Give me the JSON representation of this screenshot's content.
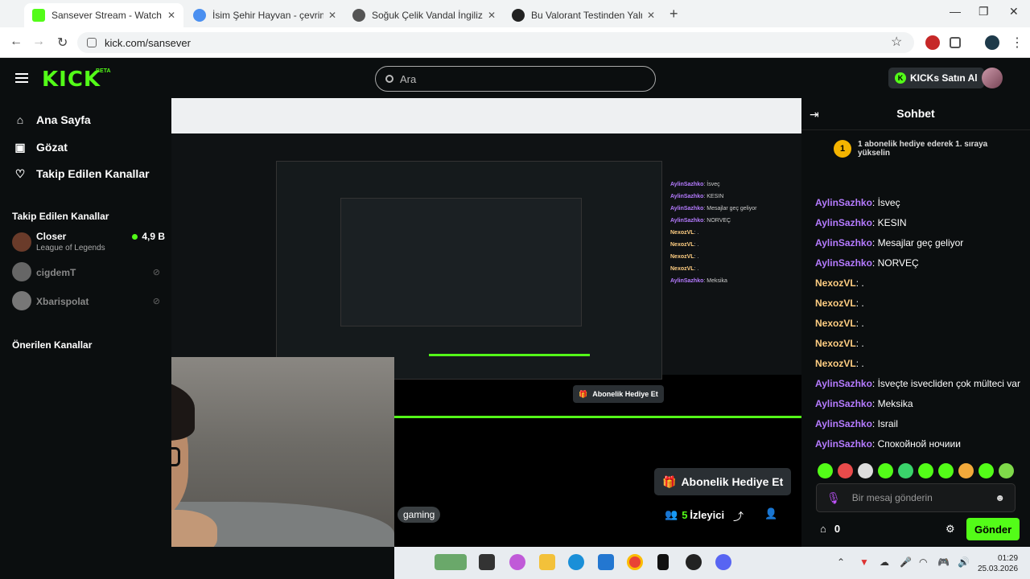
{
  "browser": {
    "tabs": [
      {
        "title": "Sansever Stream - Watch Live o",
        "favicon_color": "#53fc18",
        "active": true
      },
      {
        "title": "İsim Şehir Hayvan - çevrimiçi o",
        "favicon_color": "#4a8ff0",
        "active": false
      },
      {
        "title": "Soğuk Çelik Vandal İngilizcesi",
        "favicon_color": "#555555",
        "active": false
      },
      {
        "title": "Bu Valorant Testinden Yalnızca",
        "favicon_color": "#222222",
        "active": false
      }
    ],
    "url": "kick.com/sansever"
  },
  "header": {
    "logo": "KICK",
    "beta": "BETA",
    "search_placeholder": "Ara",
    "buy_kicks": "KICKs Satın Al"
  },
  "sidebar": {
    "nav": [
      {
        "label": "Ana Sayfa",
        "icon": "home-icon"
      },
      {
        "label": "Gözat",
        "icon": "browse-icon"
      },
      {
        "label": "Takip Edilen Kanallar",
        "icon": "heart-icon"
      }
    ],
    "followed_title": "Takip Edilen Kanallar",
    "channels": [
      {
        "name": "Closer",
        "game": "League of Legends",
        "viewers": "4,9 B",
        "live": true
      },
      {
        "name": "cigdemT",
        "live": false
      },
      {
        "name": "Xbarispolat",
        "live": false
      }
    ],
    "recommended_title": "Önerilen Kanallar"
  },
  "stream": {
    "gift_label": "Abonelik Hediye Et",
    "tag": "gaming",
    "viewers": "5",
    "viewers_label": "İzleyici"
  },
  "chat": {
    "title": "Sohbet",
    "pinned": "1 abonelik hediye ederek 1. sıraya yükselin",
    "pinned_badge": "1",
    "messages": [
      {
        "user": "AylinSazhko",
        "text": "İsveç"
      },
      {
        "user": "AylinSazhko",
        "text": "KESIN"
      },
      {
        "user": "AylinSazhko",
        "text": "Mesajlar geç geliyor"
      },
      {
        "user": "AylinSazhko",
        "text": "NORVEÇ"
      },
      {
        "user": "NexozVL",
        "text": "."
      },
      {
        "user": "NexozVL",
        "text": "."
      },
      {
        "user": "NexozVL",
        "text": "."
      },
      {
        "user": "NexozVL",
        "text": "."
      },
      {
        "user": "NexozVL",
        "text": "."
      },
      {
        "user": "AylinSazhko",
        "text": "İsveçte isvecliden çok mülteci var"
      },
      {
        "user": "AylinSazhko",
        "text": "Meksika"
      },
      {
        "user": "AylinSazhko",
        "text": "Israil"
      },
      {
        "user": "AylinSazhko",
        "text": "Спокойной ночиии"
      }
    ],
    "input_placeholder": "Bir mesaj gönderin",
    "points": "0",
    "send_label": "Gönder"
  },
  "taskbar": {
    "time": "01:29",
    "date": "25.03.2026"
  }
}
